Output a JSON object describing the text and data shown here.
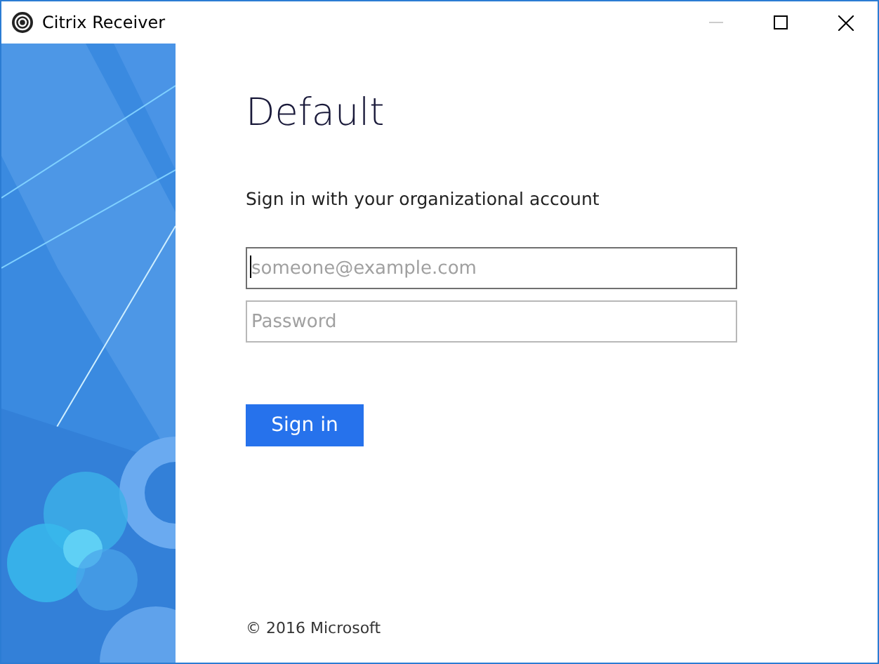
{
  "window": {
    "title": "Citrix Receiver",
    "minimize_disabled": true
  },
  "heading": "Default",
  "prompt": "Sign in with your organizational account",
  "fields": [
    {
      "placeholder": "someone@example.com",
      "focused": true
    },
    {
      "placeholder": "Password",
      "focused": false
    }
  ],
  "button": "Sign in",
  "footer": "© 2016 Microsoft"
}
